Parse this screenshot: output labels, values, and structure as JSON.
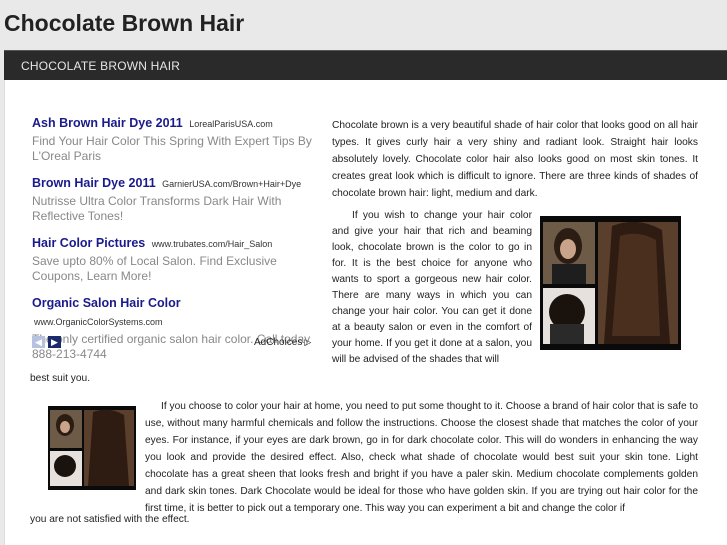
{
  "site": {
    "title": "Chocolate Brown Hair"
  },
  "nav": {
    "items": [
      {
        "label": "CHOCOLATE BROWN HAIR"
      }
    ]
  },
  "ads": [
    {
      "title": "Ash Brown Hair Dye 2011",
      "url": "LorealParisUSA.com",
      "desc": "Find Your Hair Color This Spring With Expert Tips By L'Oreal Paris"
    },
    {
      "title": "Brown Hair Dye 2011",
      "url": "GarnierUSA.com/Brown+Hair+Dye",
      "desc": "Nutrisse Ultra Color Transforms Dark Hair With Reflective Tones!"
    },
    {
      "title": "Hair Color Pictures",
      "url": "www.trubates.com/Hair_Salon",
      "desc": "Save upto 80% of Local Salon. Find Exclusive Coupons, Learn More!"
    },
    {
      "title": "Organic Salon Hair Color",
      "url": "www.OrganicColorSystems.com",
      "desc": "The only certified organic salon hair color. Call today 888-213-4744"
    }
  ],
  "adnav": {
    "prev_icon": "chevron-left-icon",
    "next_icon": "chevron-right-icon",
    "adchoices_label": "AdChoices"
  },
  "article": {
    "p1": "Chocolate brown is a very beautiful shade of hair color that looks good on all hair types. It gives curly hair a very shiny and radiant look. Straight hair looks absolutely lovely. Chocolate color hair also looks good on most skin tones. It creates great look which is difficult to ignore. There are three kinds of shades of chocolate brown hair: light, medium and dark.",
    "p2": "If you wish to change your hair color and give your hair that rich and beaming look, chocolate brown is the color to go in for. It is the best choice for anyone who wants to sport a gorgeous new hair color. There are many ways in which you can change your hair color. You can get it done at a beauty salon or even in the comfort of your home. If you get it done at a salon, you will be advised of the shades that will",
    "p2_tail": "best suit you.",
    "p3": "If you choose to color your hair at home, you need to put some thought to it. Choose a brand of hair color that is safe to use, without many harmful chemicals and follow the instructions.  Choose the closest shade that matches the color of your eyes. For instance, if your eyes are dark brown, go in for dark chocolate color. This will do wonders in enhancing the way you look and provide the desired effect. Also, check what shade of chocolate would best suit your skin tone. Light chocolate has a great sheen that looks fresh and bright if you have a paler skin.  Medium chocolate complements golden and dark skin tones. Dark Chocolate would be ideal for those who have golden skin. If you are trying out hair color for the first time, it is better to pick out a temporary one. This way you can experiment a bit and change the color if",
    "p3_tail": "you are not satisfied with the effect."
  }
}
